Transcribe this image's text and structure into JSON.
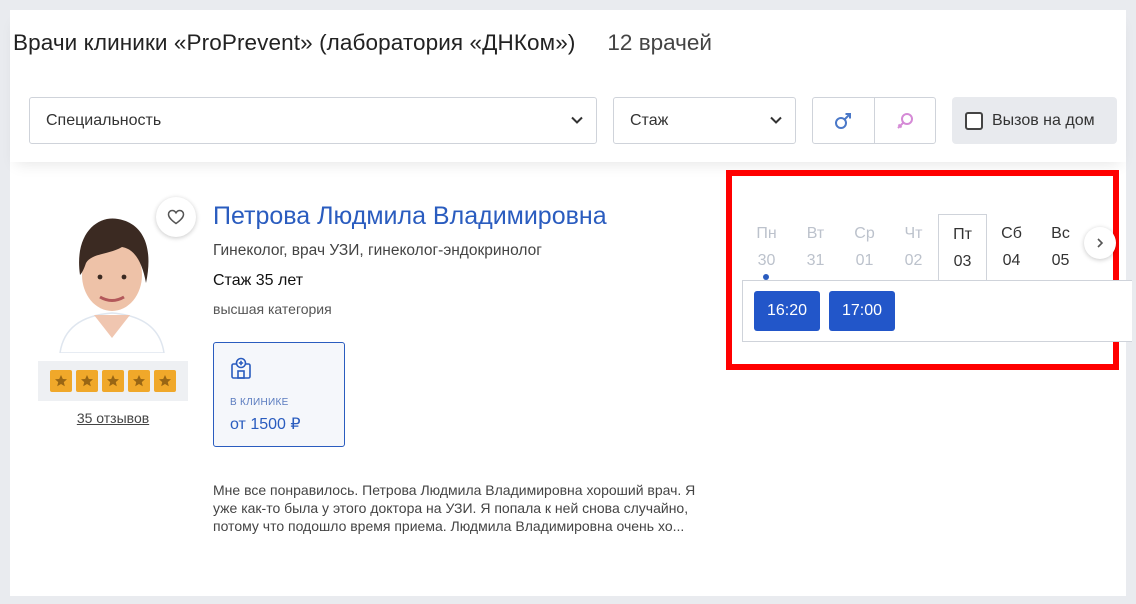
{
  "header": {
    "title": "Врачи клиники «ProPrevent» (лаборатория «ДНКом»)",
    "count": "12 врачей"
  },
  "filters": {
    "specialty_label": "Специальность",
    "experience_label": "Стаж",
    "gender_male_icon": "male-icon",
    "gender_female_icon": "female-icon",
    "home_call_label": "Вызов на дом",
    "home_call_checked": false
  },
  "doctor": {
    "name": "Петрова Людмила Владимировна",
    "specialties": "Гинеколог, врач УЗИ, гинеколог-эндокринолог",
    "experience": "Стаж 35 лет",
    "category": "высшая категория",
    "rating": 5,
    "reviews_link": "35 отзывов",
    "price": {
      "label": "В КЛИНИКЕ",
      "value": "от 1500 ₽"
    },
    "review_excerpt": "Мне все понравилось. Петрова Людмила Владимировна хороший врач. Я уже как-то была у этого доктора на УЗИ. Я попала к ней снова случайно, потому что подошло время приема. Людмила Владимировна очень хо..."
  },
  "schedule": {
    "days": [
      {
        "name": "Пн",
        "date": "30",
        "state": "disabled",
        "marked": true
      },
      {
        "name": "Вт",
        "date": "31",
        "state": "disabled",
        "marked": false
      },
      {
        "name": "Ср",
        "date": "01",
        "state": "disabled",
        "marked": false
      },
      {
        "name": "Чт",
        "date": "02",
        "state": "disabled",
        "marked": false
      },
      {
        "name": "Пт",
        "date": "03",
        "state": "active",
        "marked": false
      },
      {
        "name": "Сб",
        "date": "04",
        "state": "available",
        "marked": false
      },
      {
        "name": "Вс",
        "date": "05",
        "state": "available",
        "marked": false
      }
    ],
    "slots": [
      "16:20",
      "17:00"
    ]
  },
  "colors": {
    "accent": "#2a5cbf",
    "slot": "#2256c9",
    "star": "#f0a82a",
    "highlight": "#ff0000"
  }
}
